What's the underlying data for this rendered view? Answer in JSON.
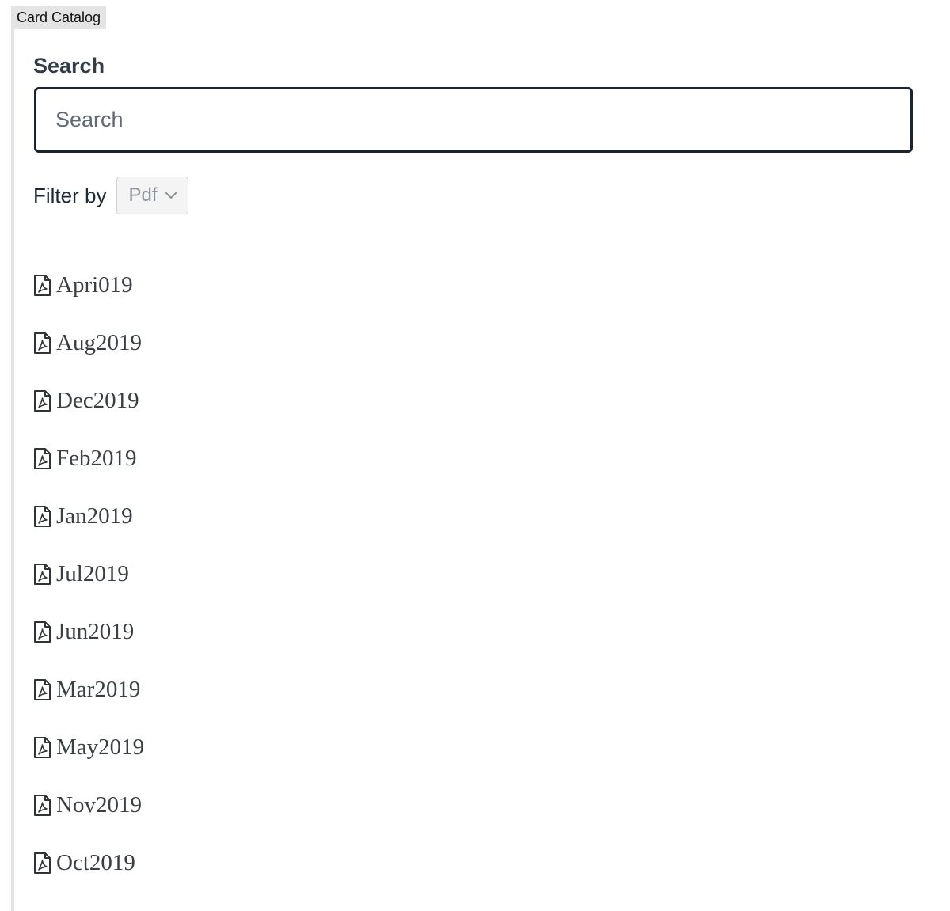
{
  "panel": {
    "title": "Card Catalog"
  },
  "search": {
    "heading": "Search",
    "placeholder": "Search",
    "value": "",
    "icon": "search-icon"
  },
  "filter": {
    "label": "Filter by",
    "selected": "Pdf",
    "icon": "chevron-down-icon"
  },
  "files": {
    "icon": "pdf-file-icon",
    "items": [
      {
        "name": "Apri019"
      },
      {
        "name": "Aug2019"
      },
      {
        "name": "Dec2019"
      },
      {
        "name": "Feb2019"
      },
      {
        "name": "Jan2019"
      },
      {
        "name": "Jul2019"
      },
      {
        "name": "Jun2019"
      },
      {
        "name": "Mar2019"
      },
      {
        "name": "May2019"
      },
      {
        "name": "Nov2019"
      },
      {
        "name": "Oct2019"
      }
    ]
  }
}
